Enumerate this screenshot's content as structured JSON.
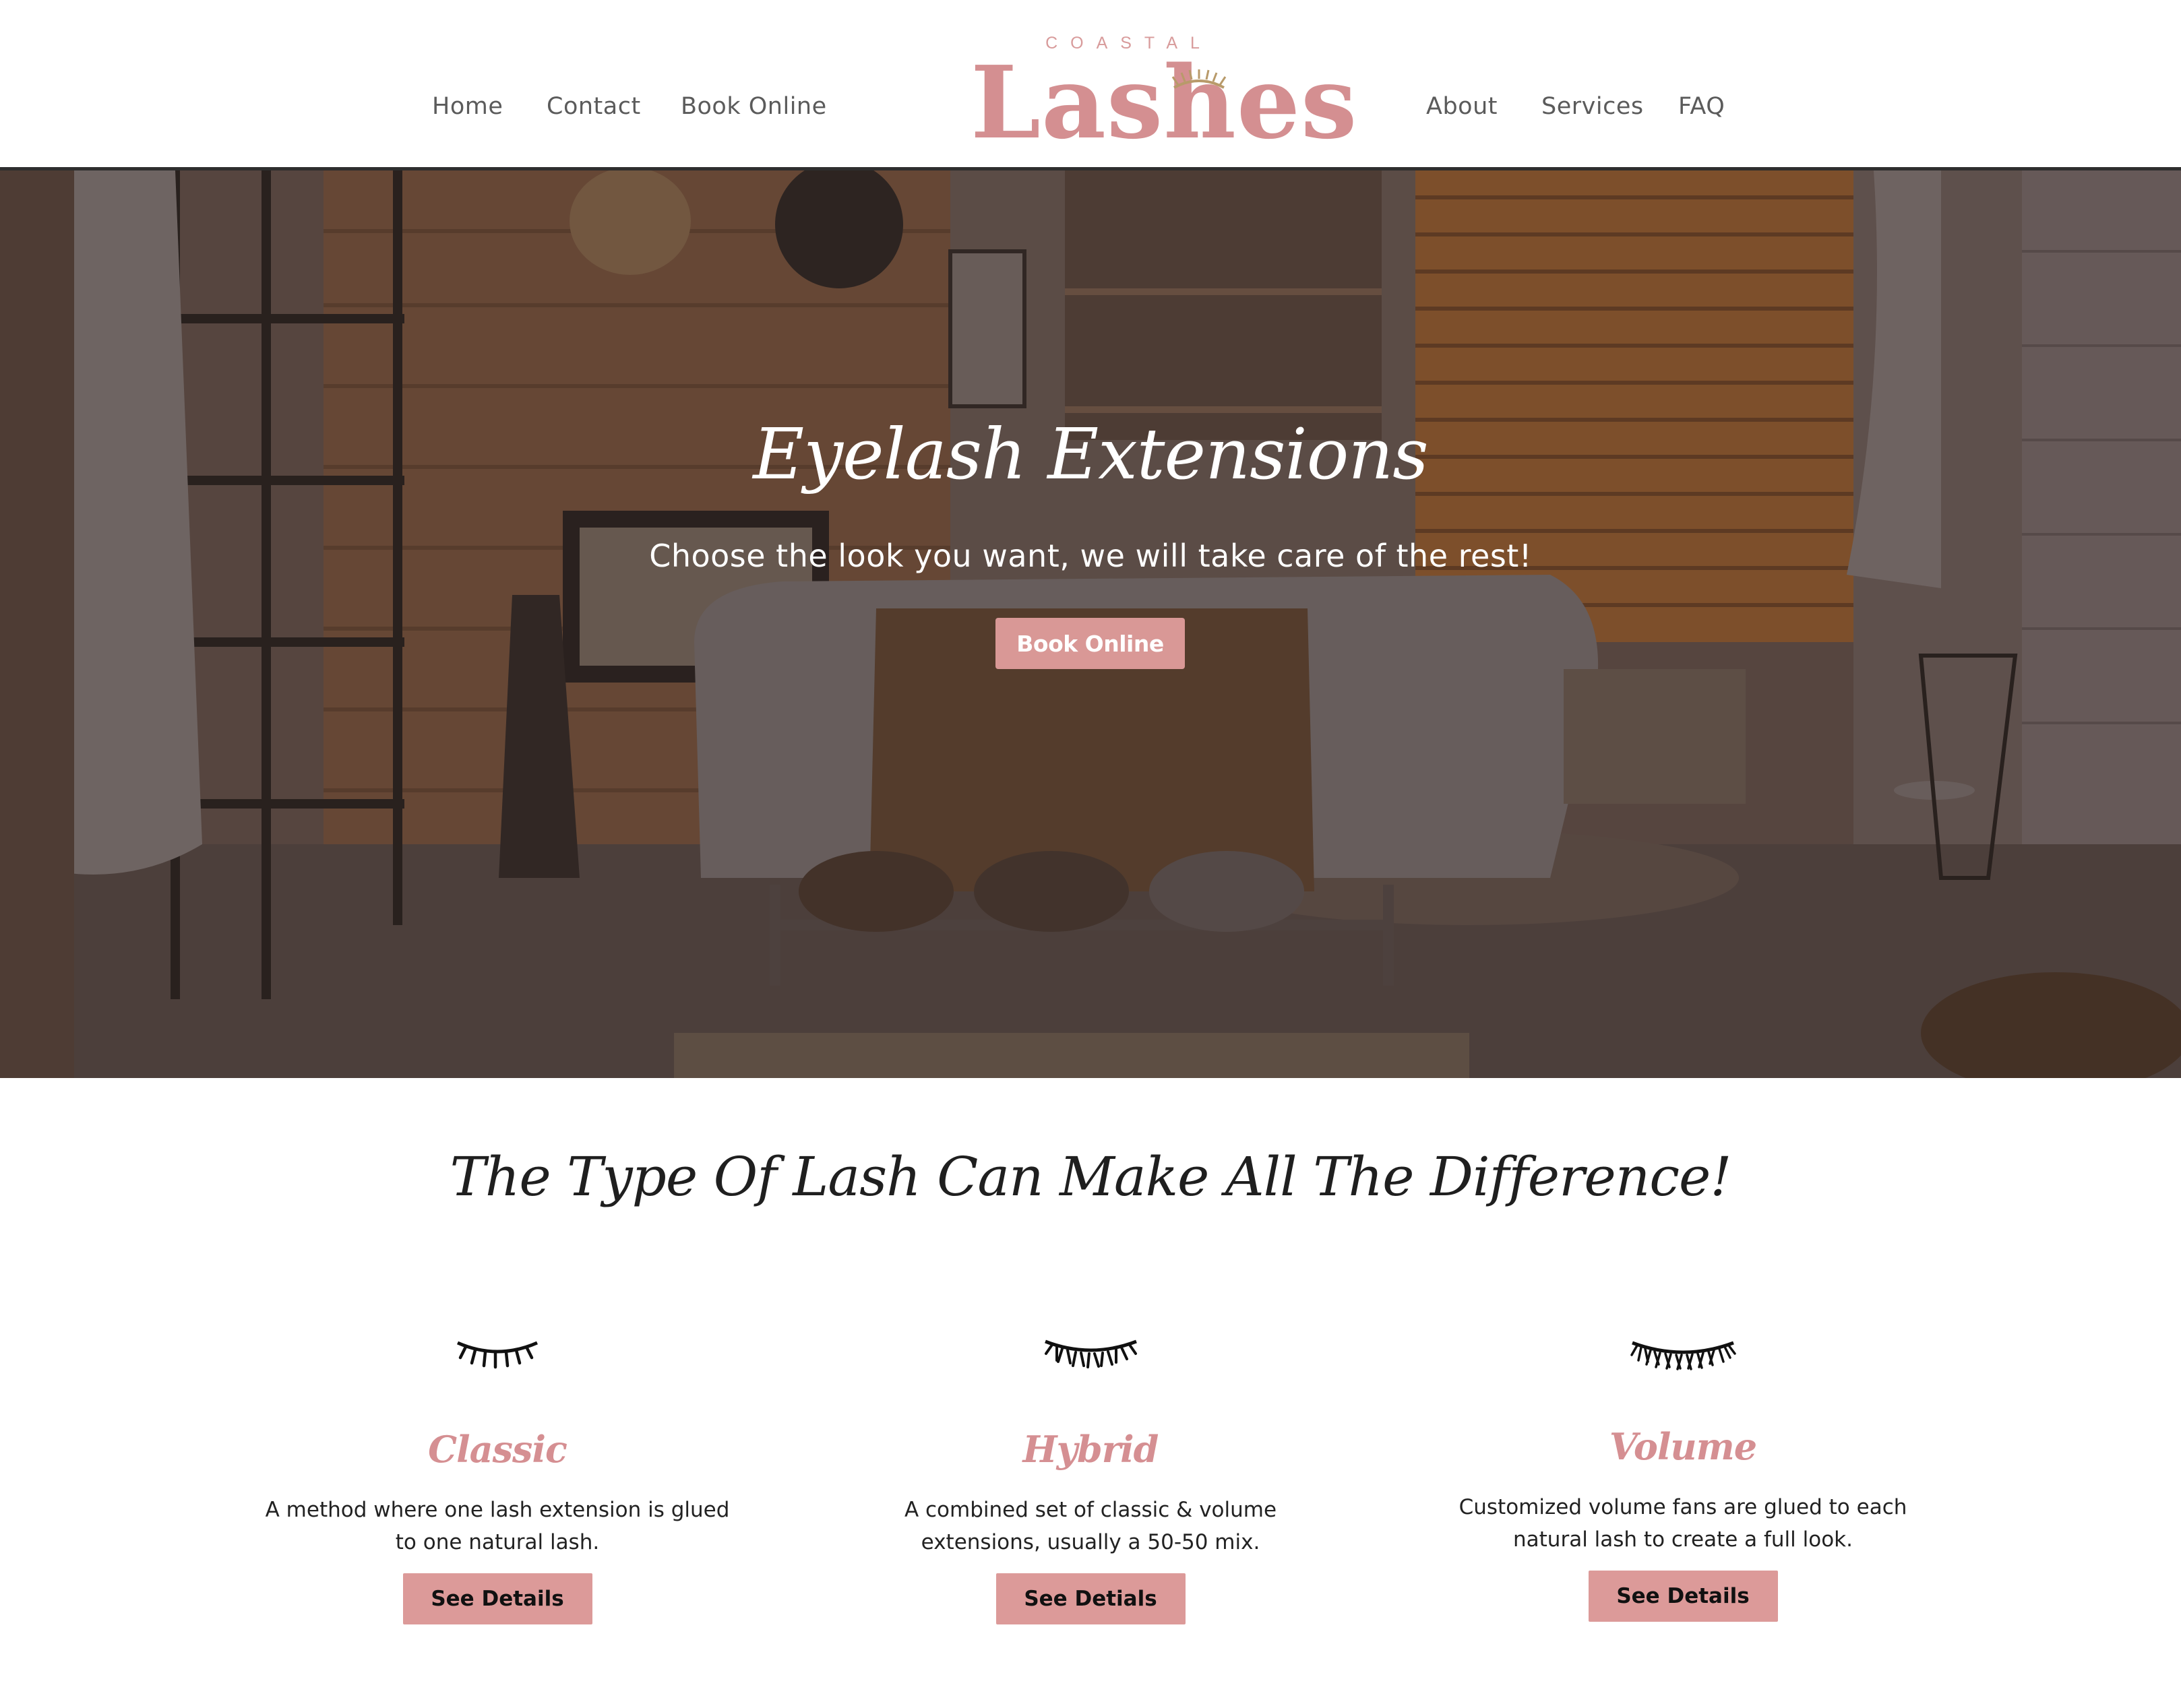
{
  "header": {
    "nav_left": [
      "Home",
      "Contact",
      "Book Online"
    ],
    "nav_right": [
      "About",
      "Services",
      "FAQ"
    ],
    "logo_small": "COASTAL",
    "logo_big": "Lashes"
  },
  "hero": {
    "title": "Eyelash Extensions",
    "subtitle": "Choose the look you want, we will take care of the rest!",
    "button": "Book Online"
  },
  "lash_types": {
    "title": "The Type Of Lash Can Make All The Difference!",
    "cards": [
      {
        "icon": "classic-lash-icon",
        "title": "Classic",
        "description": "A method where one lash extension is glued to one natural lash.",
        "button": "See Details"
      },
      {
        "icon": "hybrid-lash-icon",
        "title": "Hybrid",
        "description": "A combined set of classic & volume extensions, usually a 50-50 mix.",
        "button": "See Detials"
      },
      {
        "icon": "volume-lash-icon",
        "title": "Volume",
        "description": "Customized volume fans are glued to each natural lash to create a full look.",
        "button": "See Details"
      }
    ]
  },
  "colors": {
    "accent": "#d99896",
    "logo": "#d48f91",
    "text_dark": "#1f1f1f",
    "nav_text": "#5b5b5b"
  }
}
